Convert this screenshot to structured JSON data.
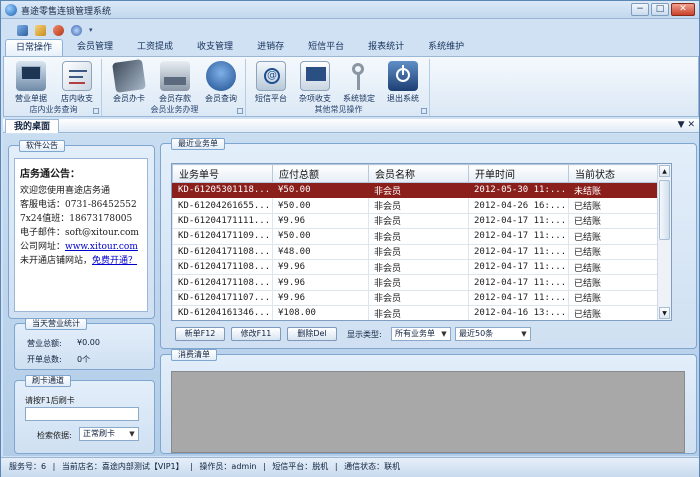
{
  "window": {
    "title": "喜途零售连锁管理系统",
    "min": "−",
    "max": "□",
    "close": "✕"
  },
  "ribbon_tabs": [
    "日常操作",
    "会员管理",
    "工资提成",
    "收支管理",
    "进销存",
    "短信平台",
    "报表统计",
    "系统维护"
  ],
  "ribbon_groups": [
    {
      "name": "店内业务查询",
      "buttons": [
        {
          "label": "营业单据",
          "icon": "monitor-icon"
        },
        {
          "label": "店内收支",
          "icon": "document-icon"
        }
      ]
    },
    {
      "name": "会员业务办理",
      "buttons": [
        {
          "label": "会员办卡",
          "icon": "card-icon"
        },
        {
          "label": "会员存款",
          "icon": "card-reader-icon"
        },
        {
          "label": "会员查询",
          "icon": "member-search-icon"
        }
      ]
    },
    {
      "name": "其他常见操作",
      "buttons": [
        {
          "label": "短信平台",
          "icon": "email-icon"
        },
        {
          "label": "杂项收支",
          "icon": "ledger-icon"
        },
        {
          "label": "系统锁定",
          "icon": "key-icon"
        },
        {
          "label": "退出系统",
          "icon": "exit-icon"
        }
      ]
    }
  ],
  "desktop_tab": "我的桌面",
  "desktop_controls": "▼ ✕",
  "software_notice": {
    "label": "软件公告",
    "title": "店务通公告：",
    "lines": [
      "欢迎您使用喜途店务通",
      "客服电话：0731-86452552",
      "7x24值班：18673178005",
      "电子邮件：soft@xitour.com"
    ],
    "website_label": "公司网址：",
    "website": "www.xitour.com",
    "open_text": "未开通店铺网站，",
    "open_link": "免费开通？"
  },
  "daily_stats": {
    "label": "当天营业统计",
    "revenue_label": "营业总额:",
    "revenue_value": "¥0.00",
    "orders_label": "开单总数:",
    "orders_value": "0个"
  },
  "card_channel": {
    "label": "刷卡通道",
    "prompt": "请按F1后刷卡",
    "search_label": "检索依据:",
    "search_value": "正常刷卡"
  },
  "recent_orders": {
    "label": "最近业务单",
    "columns": [
      "业务单号",
      "应付总额",
      "会员名称",
      "开单时间",
      "当前状态"
    ],
    "rows": [
      [
        "KD-61205301118...",
        "¥50.00",
        "非会员",
        "2012-05-30 11:...",
        "未结账"
      ],
      [
        "KD-61204261655...",
        "¥50.00",
        "非会员",
        "2012-04-26 16:...",
        "已结账"
      ],
      [
        "KD-61204171111...",
        "¥9.96",
        "非会员",
        "2012-04-17 11:...",
        "已结账"
      ],
      [
        "KD-61204171109...",
        "¥50.00",
        "非会员",
        "2012-04-17 11:...",
        "已结账"
      ],
      [
        "KD-61204171108...",
        "¥48.00",
        "非会员",
        "2012-04-17 11:...",
        "已结账"
      ],
      [
        "KD-61204171108...",
        "¥9.96",
        "非会员",
        "2012-04-17 11:...",
        "已结账"
      ],
      [
        "KD-61204171108...",
        "¥9.96",
        "非会员",
        "2012-04-17 11:...",
        "已结账"
      ],
      [
        "KD-61204171107...",
        "¥9.96",
        "非会员",
        "2012-04-17 11:...",
        "已结账"
      ],
      [
        "KD-61204161346...",
        "¥108.00",
        "非会员",
        "2012-04-16 13:...",
        "已结账"
      ]
    ],
    "buttons": {
      "new": "新单F12",
      "edit": "修改F11",
      "delete": "删除Del"
    },
    "filter_label": "显示类型:",
    "filter_type": "所有业务单",
    "filter_range": "最近50条"
  },
  "consume_list": {
    "label": "消费清单"
  },
  "status_bar": [
    "服务号：6",
    "当前店名：喜途内部测试【VIP1】",
    "操作员：admin",
    "短信平台：脱机",
    "通信状态：联机"
  ],
  "status_sep": "|",
  "colors": {
    "selected_row": "#8a1f1c",
    "accent": "#1d5fb3",
    "link": "#0000cc"
  }
}
